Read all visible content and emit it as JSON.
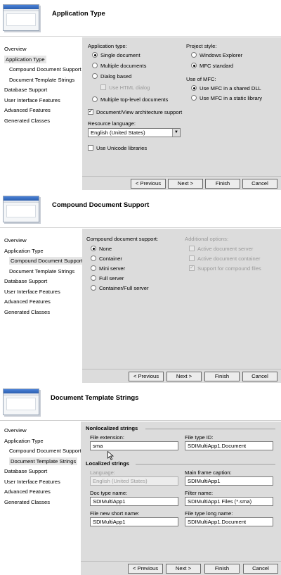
{
  "nav_items": [
    "Overview",
    "Application Type",
    "Compound Document Support",
    "Document Template Strings",
    "Database Support",
    "User Interface Features",
    "Advanced Features",
    "Generated Classes"
  ],
  "buttons": {
    "previous": "< Previous",
    "next": "Next >",
    "finish": "Finish",
    "cancel": "Cancel"
  },
  "panel1": {
    "title": "Application Type",
    "app_type_label": "Application type:",
    "single_doc": "Single document",
    "multiple_docs": "Multiple documents",
    "dialog_based": "Dialog based",
    "use_html_dialog": "Use HTML dialog",
    "multiple_top_level": "Multiple top-level documents",
    "doc_view": "Document/View architecture support",
    "resource_language_label": "Resource language:",
    "resource_language_value": "English (United States)",
    "use_unicode": "Use Unicode libraries",
    "project_style_label": "Project style:",
    "windows_explorer": "Windows Explorer",
    "mfc_standard": "MFC standard",
    "use_of_mfc_label": "Use of MFC:",
    "mfc_shared": "Use MFC in a shared DLL",
    "mfc_static": "Use MFC in a static library"
  },
  "panel2": {
    "title": "Compound Document Support",
    "support_label": "Compound document support:",
    "options": [
      "None",
      "Container",
      "Mini server",
      "Full server",
      "Container/Full server"
    ],
    "additional_label": "Additional options:",
    "active_doc_server": "Active document server",
    "active_doc_container": "Active document container",
    "support_compound_files": "Support for compound files"
  },
  "panel3": {
    "title": "Document Template Strings",
    "nonlocalized": "Nonlocalized strings",
    "file_ext_label": "File extension:",
    "file_ext_value": "sma",
    "file_type_id_label": "File type ID:",
    "file_type_id_value": "SDIMultiApp1.Document",
    "localized": "Localized strings",
    "language_label": "Language:",
    "language_value": "English (United States)",
    "main_frame_caption_label": "Main frame caption:",
    "main_frame_caption_value": "SDIMultiApp1",
    "doc_type_name_label": "Doc type name:",
    "doc_type_name_value": "SDIMultiApp1",
    "filter_name_label": "Filter name:",
    "filter_name_value": "SDIMultiApp1 Files (*.sma)",
    "file_new_short_label": "File new short name:",
    "file_new_short_value": "SDIMultiApp1",
    "file_type_long_label": "File type long name:",
    "file_type_long_value": "SDIMultiApp1.Document"
  }
}
